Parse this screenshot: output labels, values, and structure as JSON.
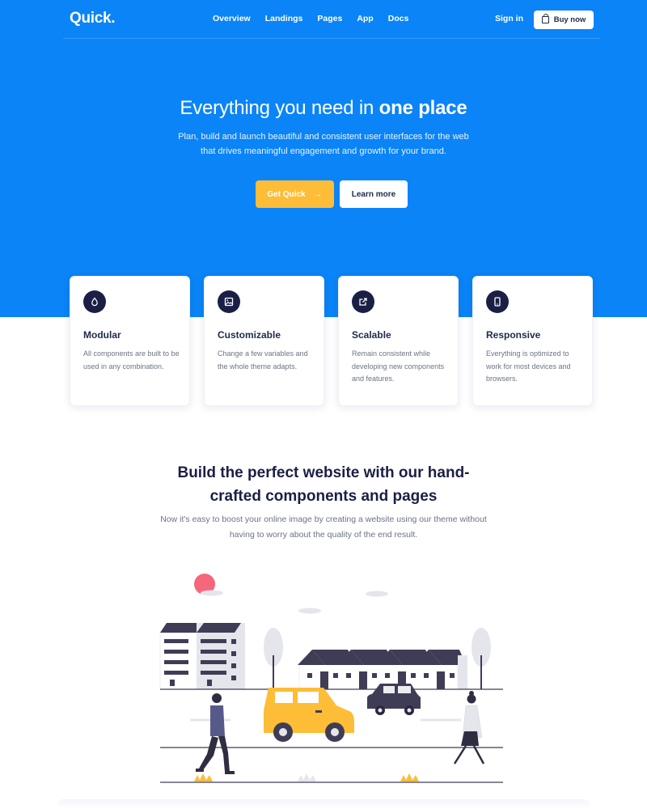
{
  "brand": {
    "logo": "Quick.",
    "accent": "#0a84f7",
    "cta_color": "#fdbd37",
    "dark": "#1b1f45"
  },
  "nav": {
    "links": [
      "Overview",
      "Landings",
      "Pages",
      "App",
      "Docs"
    ],
    "signin": "Sign in",
    "buy_now": "Buy now",
    "buy_icon": "shopping-bag-icon"
  },
  "hero": {
    "title_regular": "Everything you need in ",
    "title_bold": "one place",
    "subtitle": "Plan, build and launch beautiful and consistent user interfaces for the web that drives meaningful engagement and growth for your brand.",
    "primary_button": "Get Quick",
    "primary_icon": "arrow-right-icon",
    "secondary_button": "Learn more"
  },
  "features": [
    {
      "icon": "droplet-icon",
      "title": "Modular",
      "text": "All components are built to be used in any combination."
    },
    {
      "icon": "image-icon",
      "title": "Customizable",
      "text": "Change a few variables and the whole theme adapts."
    },
    {
      "icon": "external-link-icon",
      "title": "Scalable",
      "text": "Remain consistent while developing new components and features."
    },
    {
      "icon": "mobile-icon",
      "title": "Responsive",
      "text": "Everything is optimized to work for most devices and browsers."
    }
  ],
  "section": {
    "title": "Build the perfect website with our hand-crafted components and pages",
    "subtitle": "Now it's easy to boost your online image by creating a website using our theme without having to worry about the quality of the end result."
  }
}
